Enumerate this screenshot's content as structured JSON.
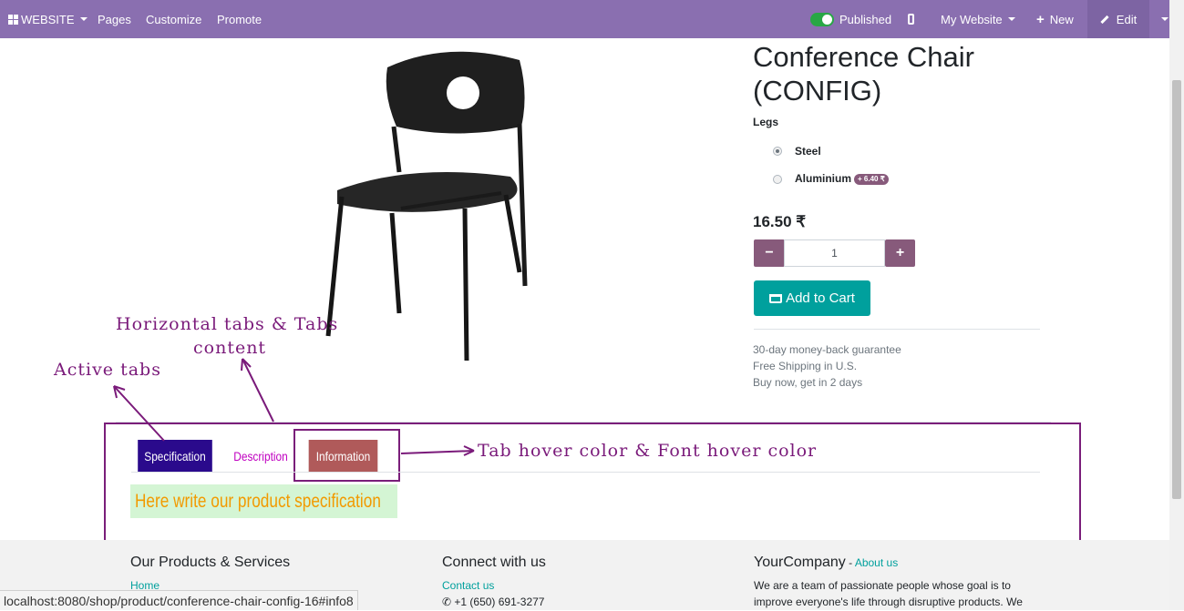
{
  "topbar": {
    "website": "WEBSITE",
    "pages": "Pages",
    "customize": "Customize",
    "promote": "Promote",
    "published": "Published",
    "my_website": "My Website",
    "new": "New",
    "edit": "Edit"
  },
  "product": {
    "title_line1": "Conference Chair",
    "title_line2": "(CONFIG)",
    "attribute_label": "Legs",
    "options": [
      {
        "label": "Steel",
        "selected": true
      },
      {
        "label": "Aluminium",
        "selected": false,
        "extra": "+ 6.40 ₹"
      }
    ],
    "price": "16.50 ₹",
    "quantity": "1",
    "add_to_cart": "Add to Cart",
    "info": [
      "30-day money-back guarantee",
      "Free Shipping in U.S.",
      "Buy now, get in 2 days"
    ]
  },
  "tabs": [
    {
      "label": "Specification",
      "state": "active",
      "bg": "#2a0a8c",
      "color": "#ffffff"
    },
    {
      "label": "Description",
      "state": "normal",
      "bg": "#ffffff",
      "color": "#c000c0"
    },
    {
      "label": "Information",
      "state": "hover",
      "bg": "#b05a5a",
      "color": "#ffffff"
    }
  ],
  "tab_content": "Here write our product specification",
  "annotations": {
    "horizontal_line1": "Horizontal tabs & Tabs",
    "horizontal_line2": "content",
    "active": "Active tabs",
    "hover": "Tab hover color & Font hover color"
  },
  "footer": {
    "col1_title": "Our Products & Services",
    "col1_link": "Home",
    "col2_title": "Connect with us",
    "col2_link": "Contact us",
    "col2_phone": "+1 (650) 691-3277",
    "col3_title": "YourCompany",
    "col3_sep": " - ",
    "col3_link": "About us",
    "col3_text1": "We are a team of passionate people whose goal is to",
    "col3_text2": "improve everyone's life through disruptive products. We"
  },
  "statusbar": "localhost:8080/shop/product/conference-chair-config-16#info8"
}
